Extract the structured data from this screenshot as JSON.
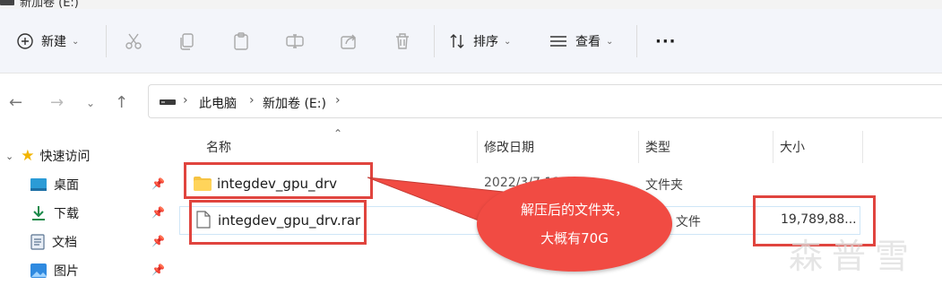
{
  "window": {
    "title": "新加卷 (E:)"
  },
  "toolbar": {
    "new_label": "新建",
    "sort_label": "排序",
    "view_label": "查看",
    "more_label": "···"
  },
  "address": {
    "crumbs": [
      "此电脑",
      "新加卷 (E:)"
    ]
  },
  "sidebar": {
    "quick_access": "快速访问",
    "items": [
      {
        "label": "桌面",
        "icon": "desktop-icon"
      },
      {
        "label": "下载",
        "icon": "download-icon"
      },
      {
        "label": "文档",
        "icon": "document-icon"
      },
      {
        "label": "图片",
        "icon": "picture-icon"
      }
    ]
  },
  "columns": {
    "name": "名称",
    "modified": "修改日期",
    "type": "类型",
    "size": "大小"
  },
  "files": [
    {
      "name": "integdev_gpu_drv",
      "modified": "2022/3/7 11:03",
      "type": "文件夹",
      "size": "",
      "icon": "folder-icon"
    },
    {
      "name": "integdev_gpu_drv.rar",
      "modified": "",
      "type": "RAR 文件",
      "size": "19,789,88...",
      "icon": "file-icon"
    }
  ],
  "annotation": {
    "line1": "解压后的文件夹，",
    "line2": "大概有70G",
    "color": "#f14b43"
  },
  "watermark": "森普雪"
}
